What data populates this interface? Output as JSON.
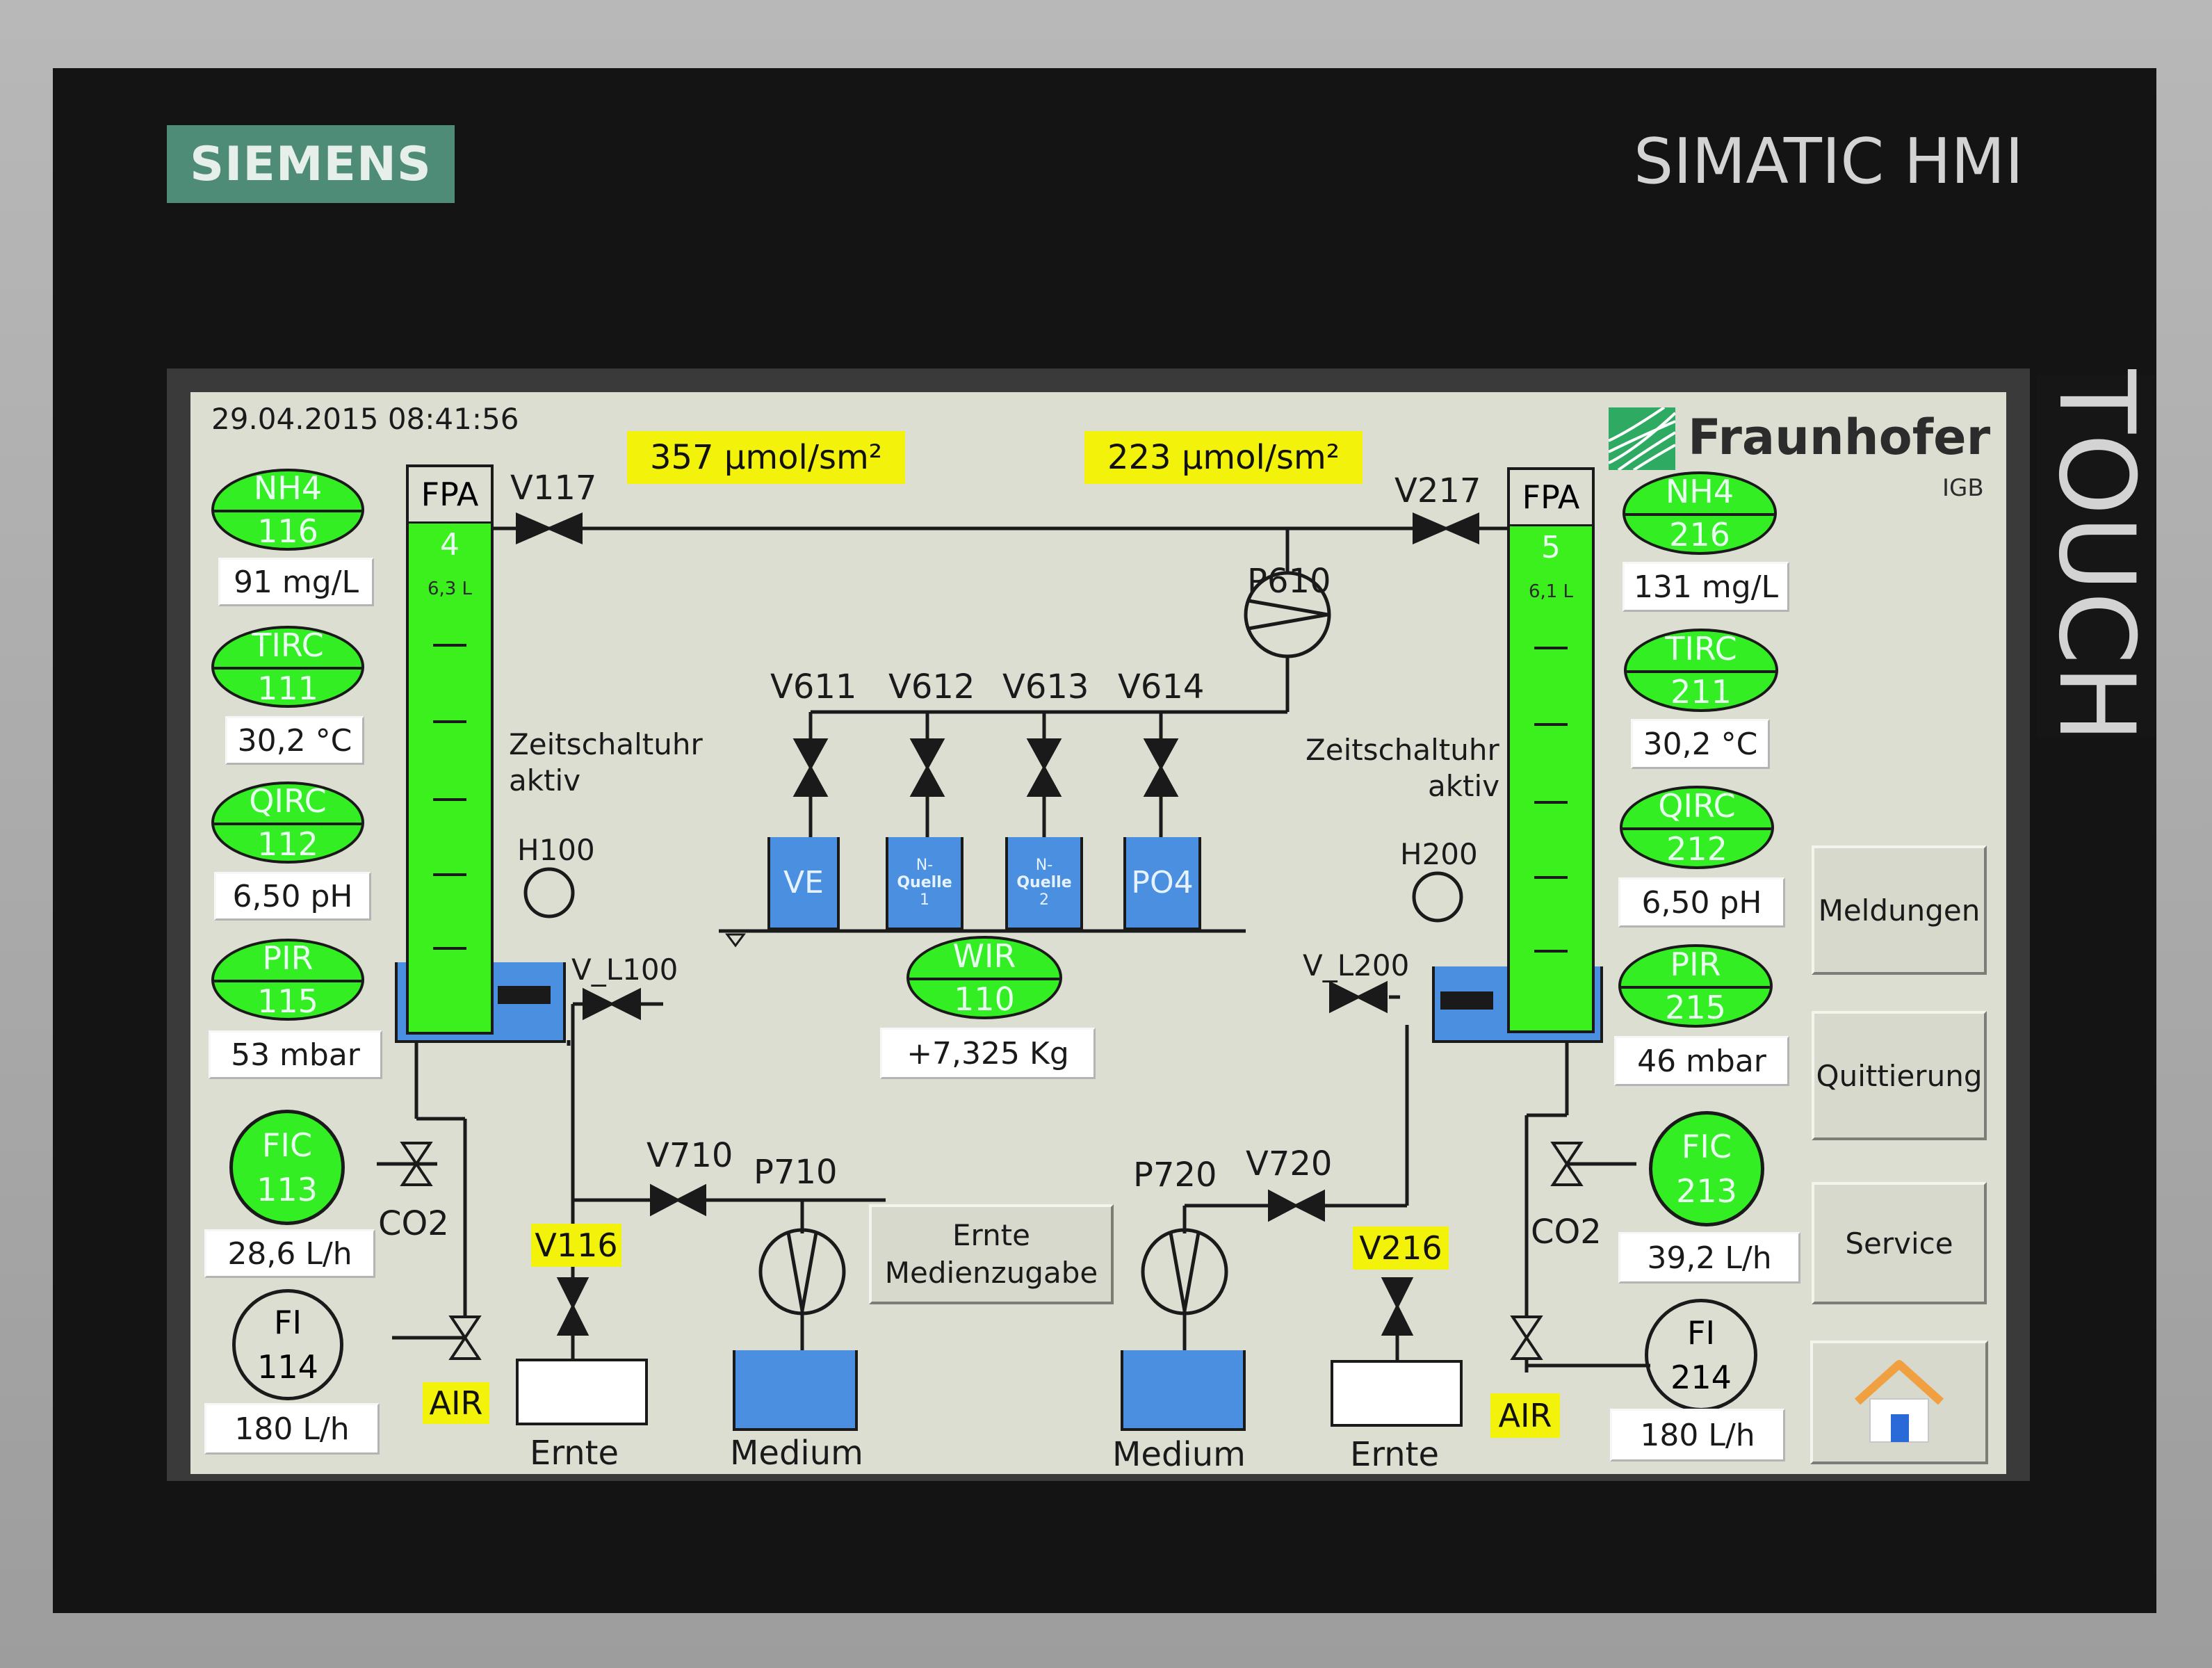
{
  "device": {
    "brand": "SIEMENS",
    "model": "SIMATIC HMI",
    "touch_label": "TOUCH"
  },
  "header": {
    "datetime": "29.04.2015 08:41:56",
    "logo_text": "Fraunhofer",
    "logo_sub": "IGB",
    "light_left": "357 µmol/sm²",
    "light_right": "223 µmol/sm²"
  },
  "left": {
    "column": {
      "label": "FPA",
      "number": "4",
      "volume": "6,3 L"
    },
    "valve_top": "V117",
    "heater": "H100",
    "valve_level": "V_L100",
    "timer_text": "Zeitschaltuhr",
    "timer_state": "aktiv",
    "sensors": [
      {
        "tag": "NH4",
        "id": "116",
        "value": "91 mg/L"
      },
      {
        "tag": "TIRC",
        "id": "111",
        "value": "30,2 °C"
      },
      {
        "tag": "QIRC",
        "id": "112",
        "value": "6,50 pH"
      },
      {
        "tag": "PIR",
        "id": "115",
        "value": "53 mbar"
      }
    ],
    "fic": {
      "tag": "FIC",
      "id": "113",
      "value": "28,6 L/h"
    },
    "fi": {
      "tag": "FI",
      "id": "114",
      "value": "180 L/h"
    },
    "co2": "CO2",
    "air": "AIR",
    "harvest_valve": "V116",
    "harvest_label": "Ernte",
    "medium_valve": "V710",
    "medium_pump": "P710",
    "medium_label": "Medium"
  },
  "right": {
    "column": {
      "label": "FPA",
      "number": "5",
      "volume": "6,1 L"
    },
    "valve_top": "V217",
    "heater": "H200",
    "valve_level": "V_L200",
    "timer_text": "Zeitschaltuhr",
    "timer_state": "aktiv",
    "sensors": [
      {
        "tag": "NH4",
        "id": "216",
        "value": "131 mg/L"
      },
      {
        "tag": "TIRC",
        "id": "211",
        "value": "30,2 °C"
      },
      {
        "tag": "QIRC",
        "id": "212",
        "value": "6,50 pH"
      },
      {
        "tag": "PIR",
        "id": "215",
        "value": "46 mbar"
      }
    ],
    "fic": {
      "tag": "FIC",
      "id": "213",
      "value": "39,2 L/h"
    },
    "fi": {
      "tag": "FI",
      "id": "214",
      "value": "180 L/h"
    },
    "co2": "CO2",
    "air": "AIR",
    "harvest_valve": "V216",
    "harvest_label": "Ernte",
    "medium_valve": "V720",
    "medium_pump": "P720",
    "medium_label": "Medium"
  },
  "center": {
    "pump": "P610",
    "valves": [
      "V611",
      "V612",
      "V613",
      "V614"
    ],
    "tanks": [
      {
        "name": "VE"
      },
      {
        "name": "N-",
        "sub": "Quelle",
        "num": "1"
      },
      {
        "name": "N-",
        "sub": "Quelle",
        "num": "2"
      },
      {
        "name": "PO4"
      }
    ],
    "scale": {
      "tag": "WIR",
      "id": "110",
      "value": "+7,325 Kg"
    },
    "button": {
      "line1": "Ernte",
      "line2": "Medienzugabe"
    }
  },
  "nav": {
    "messages": "Meldungen",
    "acknowledge": "Quittierung",
    "service": "Service",
    "home_icon": "home-icon"
  },
  "colors": {
    "green": "#33ee22",
    "blue": "#4a8fe0",
    "yellow": "#f2f20a",
    "panel": "#ddded2"
  }
}
